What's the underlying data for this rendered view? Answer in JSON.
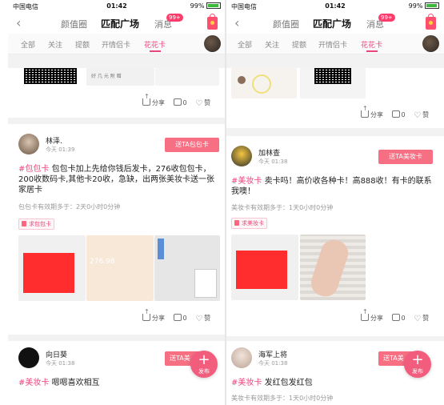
{
  "status": {
    "carrier": "中国电信",
    "time": "01:42",
    "battery": "99%"
  },
  "nav": {
    "tab1": "颜值圈",
    "tab2": "匹配广场",
    "tab3": "消息",
    "badge": "99+"
  },
  "cats": [
    "全部",
    "关注",
    "提额",
    "开情侣卡",
    "花花卡"
  ],
  "actions": {
    "share": "分享",
    "comment": "0",
    "like": "赞"
  },
  "left": {
    "top_snippet": "好 几 元 附 赠",
    "post1": {
      "name": "林泽.",
      "time": "今天 01:39",
      "button": "送TA包包卡",
      "tag": "#包包卡",
      "text": " 包包卡加上先给你钱后发卡，276收包包卡，200收数码卡,其他卡20收，急缺，出两张美妆卡送一张家居卡",
      "expire": "包包卡有效期多于：2天0小时0分钟",
      "request": "求包包卡",
      "img_number": "276.98"
    },
    "post2": {
      "name": "向日葵",
      "time": "今天 01:38",
      "button": "送TA美",
      "tag": "#美妆卡",
      "text": " 嗯嗯喜欢相互"
    }
  },
  "right": {
    "post1": {
      "name": "加林查",
      "time": "今天 01:38",
      "button": "送TA美妆卡",
      "tag": "#美妆卡",
      "text": " 卖卡吗！高价收各种卡！高888收！有卡的联系我噢！",
      "expire": "美妆卡有效期多于：1天0小时0分钟",
      "request": "求美妆卡"
    },
    "post2": {
      "name": "海军上将",
      "time": "今天 01:38",
      "button": "送TA美",
      "tag": "#美妆卡",
      "text": " 发红包发红包",
      "expire": "美妆卡有效期多于：1天0小时0分钟"
    }
  },
  "fab": {
    "label": "发布"
  }
}
